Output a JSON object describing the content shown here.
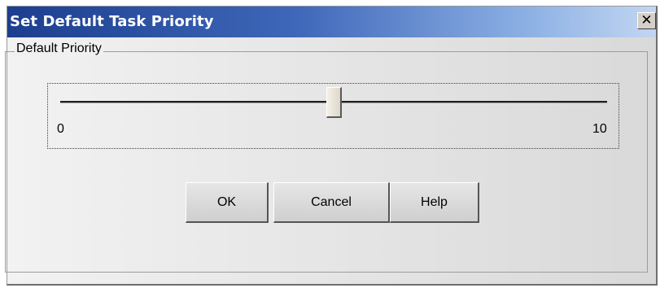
{
  "dialog": {
    "title": "Set Default Task Priority",
    "close_glyph": "✕",
    "close_icon": "close-icon"
  },
  "group": {
    "legend": "Default Priority"
  },
  "slider": {
    "min": 0,
    "max": 10,
    "value": 5,
    "min_label": "0",
    "max_label": "10"
  },
  "buttons": {
    "ok_label": "OK",
    "cancel_label": "Cancel",
    "help_label": "Help"
  },
  "colors": {
    "title_gradient_start": "#1c3e8e",
    "title_gradient_end": "#c2d6f2",
    "title_text": "#ffffff",
    "dialog_background": "#e4e4e4"
  }
}
